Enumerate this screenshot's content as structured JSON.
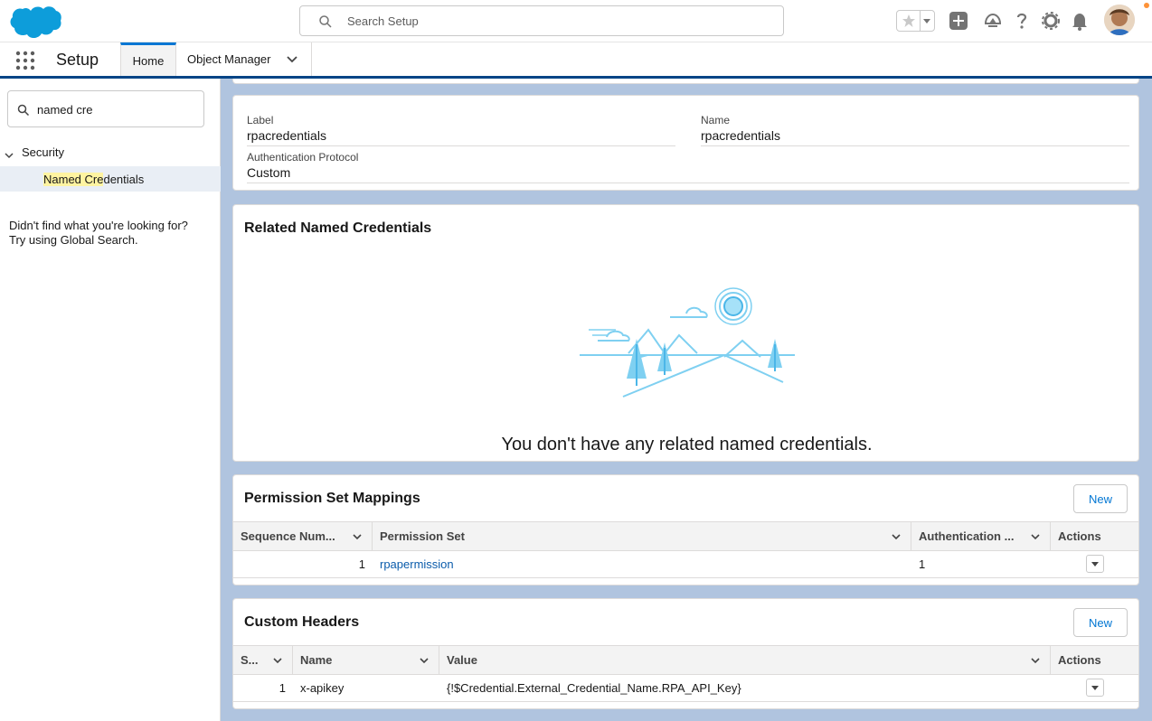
{
  "header": {
    "search_placeholder": "Search Setup",
    "icons": [
      "salesforce-logo",
      "search-icon",
      "star-icon",
      "chevron-down-icon",
      "plus-icon",
      "trailhead-icon",
      "help-icon",
      "gear-icon",
      "bell-icon",
      "avatar"
    ],
    "accent_color": "#0176d3"
  },
  "nav": {
    "app_name": "Setup",
    "tabs": [
      {
        "label": "Home"
      },
      {
        "label": "Object Manager"
      }
    ]
  },
  "sidebar": {
    "quick_find_value": "named cre",
    "section_label": "Security",
    "item_match": "Named Cre",
    "item_rest": "dentials",
    "not_found_line1": "Didn't find what you're looking for?",
    "not_found_line2": "Try using Global Search."
  },
  "detail": {
    "label_title": "Label",
    "label_value": "rpacredentials",
    "name_title": "Name",
    "name_value": "rpacredentials",
    "auth_title": "Authentication Protocol",
    "auth_value": "Custom"
  },
  "related": {
    "title": "Related Named Credentials",
    "empty_message": "You don't have any related named credentials."
  },
  "permission_mappings": {
    "title": "Permission Set Mappings",
    "new_label": "New",
    "columns": [
      "Sequence Num...",
      "Permission Set",
      "Authentication ...",
      "Actions"
    ],
    "rows": [
      {
        "sequence": "1",
        "permission_set": "rpapermission",
        "authentication": "1"
      }
    ]
  },
  "custom_headers": {
    "title": "Custom Headers",
    "new_label": "New",
    "columns": [
      "S...",
      "Name",
      "Value",
      "Actions"
    ],
    "rows": [
      {
        "sequence": "1",
        "name": "x-apikey",
        "value": "{!$Credential.External_Credential_Name.RPA_API_Key}"
      }
    ]
  }
}
